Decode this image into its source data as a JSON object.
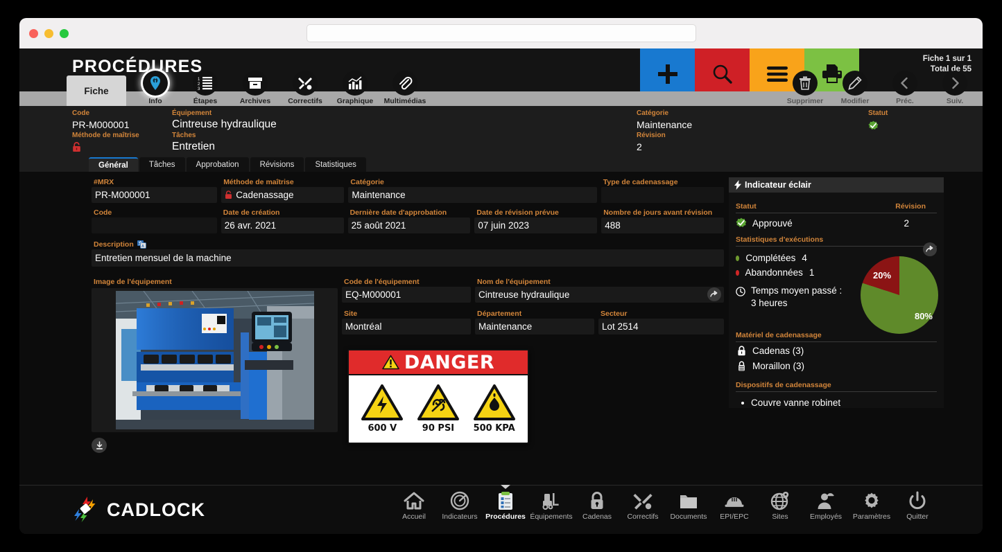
{
  "window": {
    "lights": [
      "close",
      "minimize",
      "zoom"
    ],
    "url_value": "",
    "url_placeholder": ""
  },
  "header": {
    "title": "PROCÉDURES",
    "record_position": "Fiche 1 sur 1",
    "record_total": "Total de 55"
  },
  "toolbar": {
    "buttons": [
      {
        "label": "Nouveau",
        "icon": "plus-icon",
        "color": "#1879d0"
      },
      {
        "label": "Recherche",
        "icon": "search-icon",
        "color": "#cf2026"
      },
      {
        "label": "Liste",
        "icon": "list-icon",
        "color": "#f9a31a"
      },
      {
        "label": "Impression",
        "icon": "printer-icon",
        "color": "#7cc143"
      }
    ],
    "right_actions": [
      {
        "label": "Supprimer",
        "icon": "trash-icon"
      },
      {
        "label": "Modifier",
        "icon": "pencil-icon"
      },
      {
        "label": "Préc.",
        "icon": "chevron-left-icon"
      },
      {
        "label": "Suiv.",
        "icon": "chevron-right-icon"
      }
    ]
  },
  "tabs": {
    "fiche_label": "Fiche",
    "icon_tabs": [
      {
        "label": "Info",
        "icon": "info-pin-icon",
        "active": true
      },
      {
        "label": "Étapes",
        "icon": "steps-list-icon",
        "active": false
      },
      {
        "label": "Archives",
        "icon": "archive-box-icon",
        "active": false
      },
      {
        "label": "Correctifs",
        "icon": "tools-icon",
        "active": false
      },
      {
        "label": "Graphique",
        "icon": "bar-chart-icon",
        "active": false
      },
      {
        "label": "Multimédias",
        "icon": "paperclip-icon",
        "active": false
      }
    ]
  },
  "summary": {
    "code_label": "Code",
    "code_value": "PR-M000001",
    "methode_label": "Méthode de maîtrise",
    "methode_icon": "red-lock-icon",
    "equipement_label": "Équipement",
    "equipement_value": "Cintreuse hydraulique",
    "taches_label": "Tâches",
    "taches_value": "Entretien",
    "categorie_label": "Catégorie",
    "categorie_value": "Maintenance",
    "revision_label": "Révision",
    "revision_value": "2",
    "statut_label": "Statut",
    "statut_icon": "green-check-badge-icon"
  },
  "subtabs": [
    {
      "label": "Général",
      "active": true
    },
    {
      "label": "Tâches",
      "active": false
    },
    {
      "label": "Approbation",
      "active": false
    },
    {
      "label": "Révisions",
      "active": false
    },
    {
      "label": "Statistiques",
      "active": false
    }
  ],
  "fields": {
    "row1": [
      {
        "label": "#MRX",
        "value": "PR-M000001",
        "icon": ""
      },
      {
        "label": "Méthode de maîtrise",
        "value": "Cadenassage",
        "icon": "red-lock-icon"
      },
      {
        "label": "Catégorie",
        "value": "Maintenance",
        "icon": ""
      },
      {
        "label": "Type de cadenassage",
        "value": "",
        "icon": ""
      }
    ],
    "row2": [
      {
        "label": "Code",
        "value": "",
        "icon": ""
      },
      {
        "label": "Date de création",
        "value": "26 avr. 2021",
        "icon": ""
      },
      {
        "label": "Dernière date d'approbation",
        "value": "25 août 2021",
        "icon": ""
      },
      {
        "label": "Date de révision prévue",
        "value": "07 juin 2023",
        "icon": ""
      },
      {
        "label": "Nombre de jours avant révision",
        "value": "488",
        "icon": ""
      }
    ],
    "description": {
      "label": "Description",
      "icon": "translate-icon",
      "value": "Entretien mensuel de la machine"
    },
    "image_label": "Image de l'équipement",
    "download_icon": "download-icon",
    "equipment": [
      {
        "label": "Code de l'équipement",
        "value": "EQ-M000001"
      },
      {
        "label": "Nom de l'équipement",
        "value": "Cintreuse hydraulique",
        "action_icon": "open-arrow-icon"
      },
      {
        "label": "Site",
        "value": "Montréal"
      },
      {
        "label": "Département",
        "value": "Maintenance"
      },
      {
        "label": "Secteur",
        "value": "Lot 2514"
      }
    ]
  },
  "danger_sign": {
    "title": "DANGER",
    "warning_icon": "warning-triangle-icon",
    "hazards": [
      {
        "caption": "600 V",
        "icon": "electric-bolt-icon"
      },
      {
        "caption": "90 PSI",
        "icon": "pressure-fan-icon"
      },
      {
        "caption": "500 KPA",
        "icon": "droplet-icon"
      }
    ]
  },
  "indicator_panel": {
    "title": "Indicateur éclair",
    "title_icon": "lightning-icon",
    "statut_label": "Statut",
    "revision_label": "Révision",
    "statut_value": "Approuvé",
    "statut_icon": "green-check-badge-icon",
    "revision_value": "2",
    "stats_label": "Statistiques d'exécutions",
    "share_icon": "share-arrow-icon",
    "legend": [
      {
        "label": "Complétées",
        "count": "4",
        "color": "#6f9a2f"
      },
      {
        "label": "Abandonnées",
        "count": "1",
        "color": "#d02626"
      }
    ],
    "time_icon": "clock-icon",
    "time_label": "Temps moyen passé :",
    "time_value": "3 heures",
    "materiel_label": "Matériel de cadenassage",
    "materiel": [
      {
        "label": "Cadenas (3)",
        "icon": "padlock-icon"
      },
      {
        "label": "Moraillon (3)",
        "icon": "hasp-icon"
      }
    ],
    "dispositifs_label": "Dispositifs de cadenassage",
    "dispositifs": [
      {
        "label": "Couvre vanne robinet"
      }
    ]
  },
  "chart_data": {
    "type": "pie",
    "title": "Statistiques d'exécutions",
    "categories": [
      "Complétées",
      "Abandonnées"
    ],
    "values": [
      80,
      20
    ],
    "counts": [
      4,
      1
    ],
    "labels": [
      "80%",
      "20%"
    ],
    "colors": [
      "#5f8a2a",
      "#8b1414"
    ],
    "legend_position": "left"
  },
  "footer": {
    "brand": "CADLOCK",
    "nav": [
      {
        "label": "Accueil",
        "icon": "home-icon",
        "active": false
      },
      {
        "label": "Indicateurs",
        "icon": "gauge-icon",
        "active": false
      },
      {
        "label": "Procédures",
        "icon": "clipboard-icon",
        "active": true
      },
      {
        "label": "Équipements",
        "icon": "forklift-icon",
        "active": false
      },
      {
        "label": "Cadenas",
        "icon": "padlock-icon",
        "active": false
      },
      {
        "label": "Correctifs",
        "icon": "tools-icon",
        "active": false
      },
      {
        "label": "Documents",
        "icon": "folder-icon",
        "active": false
      },
      {
        "label": "EPI/EPC",
        "icon": "helmet-icon",
        "active": false
      },
      {
        "label": "Sites",
        "icon": "globe-pin-icon",
        "active": false
      },
      {
        "label": "Employés",
        "icon": "worker-icon",
        "active": false
      },
      {
        "label": "Paramètres",
        "icon": "gear-icon",
        "active": false
      },
      {
        "label": "Quitter",
        "icon": "power-icon",
        "active": false
      }
    ]
  }
}
